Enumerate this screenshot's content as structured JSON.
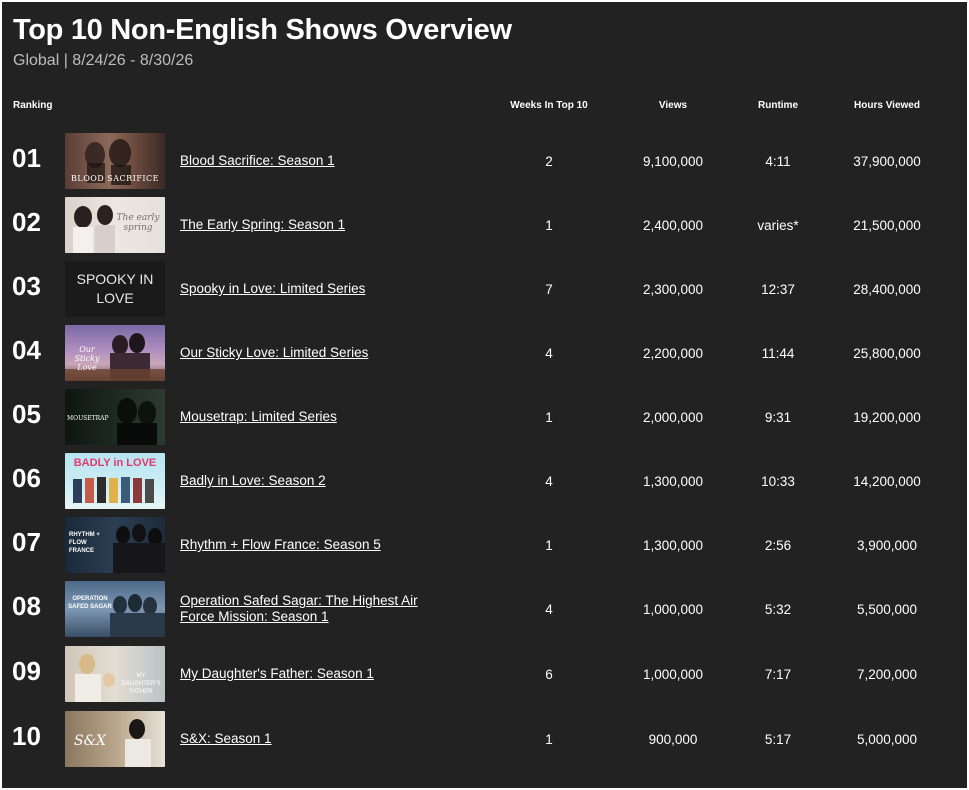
{
  "page": {
    "title": "Top 10 Non-English Shows Overview",
    "subtitle": "Global | 8/24/26 - 8/30/26"
  },
  "columns": {
    "ranking": "Ranking",
    "weeks": "Weeks In Top 10",
    "views": "Views",
    "runtime": "Runtime",
    "hours": "Hours Viewed"
  },
  "rows": [
    {
      "rank": "01",
      "show": "Blood Sacrifice: Season 1",
      "weeks": "2",
      "views": "9,100,000",
      "runtime": "4:11",
      "hours": "37,900,000",
      "thumb_text": "BLOOD SACRIFICE",
      "thumb_icon": "blood-sacrifice-poster"
    },
    {
      "rank": "02",
      "show": "The Early Spring: Season 1",
      "weeks": "1",
      "views": "2,400,000",
      "runtime": "varies*",
      "hours": "21,500,000",
      "thumb_text": "The early spring",
      "thumb_icon": "the-early-spring-poster"
    },
    {
      "rank": "03",
      "show": "Spooky in Love: Limited Series",
      "weeks": "7",
      "views": "2,300,000",
      "runtime": "12:37",
      "hours": "28,400,000",
      "thumb_text": "SPOOKY IN LOVE",
      "thumb_icon": "spooky-in-love-poster"
    },
    {
      "rank": "04",
      "show": "Our Sticky Love: Limited Series",
      "weeks": "4",
      "views": "2,200,000",
      "runtime": "11:44",
      "hours": "25,800,000",
      "thumb_text": "Our Sticky Love",
      "thumb_icon": "our-sticky-love-poster"
    },
    {
      "rank": "05",
      "show": "Mousetrap: Limited Series",
      "weeks": "1",
      "views": "2,000,000",
      "runtime": "9:31",
      "hours": "19,200,000",
      "thumb_text": "MOUSETRAP",
      "thumb_icon": "mousetrap-poster"
    },
    {
      "rank": "06",
      "show": "Badly in Love: Season 2",
      "weeks": "4",
      "views": "1,300,000",
      "runtime": "10:33",
      "hours": "14,200,000",
      "thumb_text": "BADLY in LOVE",
      "thumb_icon": "badly-in-love-poster"
    },
    {
      "rank": "07",
      "show": "Rhythm + Flow France: Season 5",
      "weeks": "1",
      "views": "1,300,000",
      "runtime": "2:56",
      "hours": "3,900,000",
      "thumb_text": "RHYTHM + FLOW FRANCE",
      "thumb_icon": "rhythm-flow-france-poster"
    },
    {
      "rank": "08",
      "show": "Operation Safed Sagar: The Highest Air Force Mission: Season 1",
      "weeks": "4",
      "views": "1,000,000",
      "runtime": "5:32",
      "hours": "5,500,000",
      "thumb_text": "OPERATION SAFED SAGAR",
      "thumb_icon": "operation-safed-sagar-poster"
    },
    {
      "rank": "09",
      "show": "My Daughter's Father: Season 1",
      "weeks": "6",
      "views": "1,000,000",
      "runtime": "7:17",
      "hours": "7,200,000",
      "thumb_text": "MY DAUGHTER'S FATHER",
      "thumb_icon": "my-daughters-father-poster"
    },
    {
      "rank": "10",
      "show": "S&X: Season 1",
      "weeks": "1",
      "views": "900,000",
      "runtime": "5:17",
      "hours": "5,000,000",
      "thumb_text": "S&X",
      "thumb_icon": "s-and-x-poster"
    }
  ],
  "colors": {
    "background": "#222222",
    "text": "#ffffff",
    "subtitle": "#bdbdbd"
  }
}
